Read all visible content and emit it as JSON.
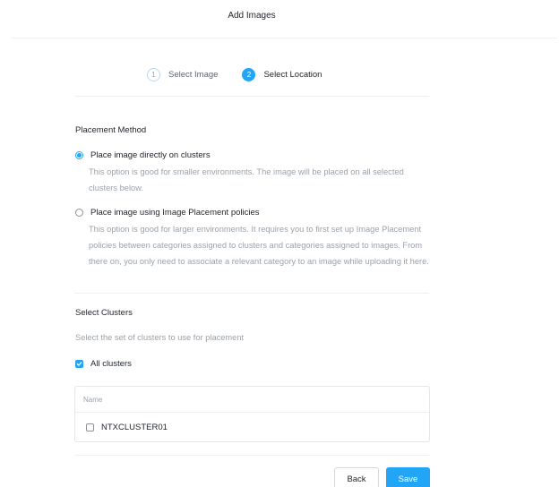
{
  "header": {
    "title": "Add Images"
  },
  "wizard": {
    "steps": [
      {
        "number": "1",
        "label": "Select Image",
        "state": "inactive"
      },
      {
        "number": "2",
        "label": "Select Location",
        "state": "active"
      }
    ]
  },
  "placement": {
    "title": "Placement Method",
    "options": [
      {
        "label": "Place image directly on clusters",
        "description": "This option is good for smaller environments. The image will be placed on all selected clusters below.",
        "selected": true
      },
      {
        "label": "Place image using Image Placement policies",
        "description": "This option is good for larger environments. It requires you to first set up Image Placement policies between categories assigned to clusters and categories assigned to images. From there on, you only need to associate a relevant category to an image while uploading it here.",
        "selected": false
      }
    ]
  },
  "clusters": {
    "title": "Select Clusters",
    "helper": "Select the set of clusters to use for placement",
    "all_clusters_label": "All clusters",
    "all_clusters_checked": true,
    "table": {
      "column_name": "Name",
      "rows": [
        {
          "name": "NTXCLUSTER01",
          "checked": false
        }
      ]
    }
  },
  "footer": {
    "back_label": "Back",
    "save_label": "Save"
  },
  "colors": {
    "accent": "#22a5f7",
    "muted_text": "#9aa2aa",
    "border": "#e3e6ea"
  }
}
